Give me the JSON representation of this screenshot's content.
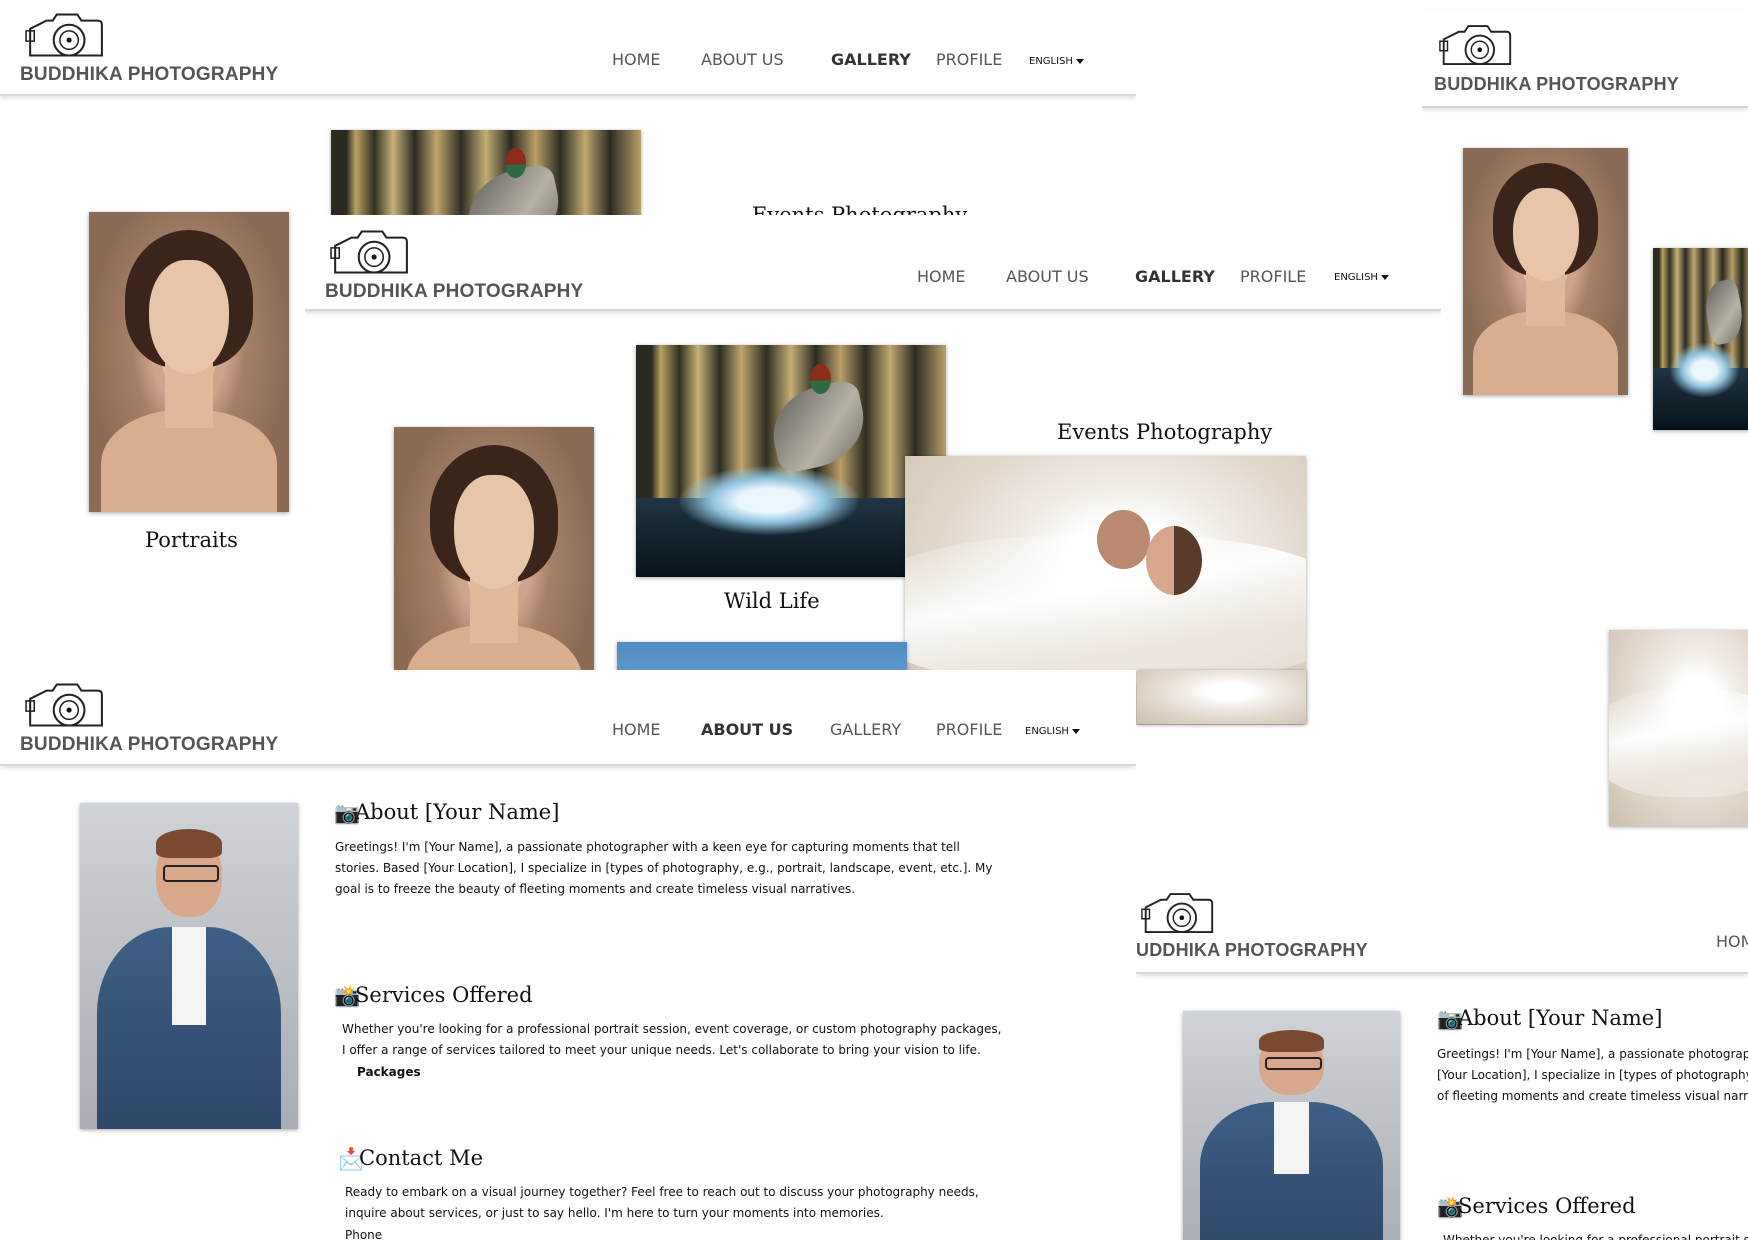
{
  "brand": {
    "name": "BUDDHIKA PHOTOGRAPHY",
    "name_cut": "UDDHIKA PHOTOGRAPHY"
  },
  "nav": {
    "home": "HOME",
    "about": "ABOUT US",
    "gallery": "GALLERY",
    "profile": "PROFILE",
    "language": "ENGLISH",
    "home_cut": "HOM"
  },
  "gallery": {
    "portraits": "Portraits",
    "wildlife": "Wild Life",
    "events": "Events Photography"
  },
  "about": {
    "heading": "About [Your Name]",
    "body": "Greetings! I'm [Your Name], a passionate photographer with a keen eye for capturing moments that tell stories. Based [Your Location], I specialize in [types of photography, e.g., portrait, landscape, event, etc.]. My goal is to freeze the beauty of fleeting moments and create timeless visual narratives.",
    "body_cut_1": "Greetings! I'm [Your Name], a passionate photographer",
    "body_cut_2": "[Your Location], I specialize in [types of photography, e.g",
    "body_cut_3": "of fleeting moments and create timeless visual narrative",
    "services_heading": "Services Offered",
    "services_body": "Whether you're looking for a professional portrait session, event coverage, or custom photography packages, I offer a range of services tailored to meet your unique needs. Let's collaborate to bring your vision to life.",
    "services_cut": "Whether you're looking for a professional portrait ses",
    "packages": "Packages",
    "contact_heading": "Contact Me",
    "contact_body": "Ready to embark on a visual journey together? Feel free to reach out to discuss your photography needs, inquire about services, or just to say hello. I'm here to turn your moments into memories.",
    "phone": "Phone"
  },
  "icons": [
    "camera-logo-icon",
    "caret-down-icon",
    "camera-emoji-icon",
    "camera-flash-emoji-icon",
    "envelope-emoji-icon"
  ],
  "colors": {
    "brand_text": "#555555",
    "nav_text": "#555555",
    "background": "#ffffff"
  }
}
